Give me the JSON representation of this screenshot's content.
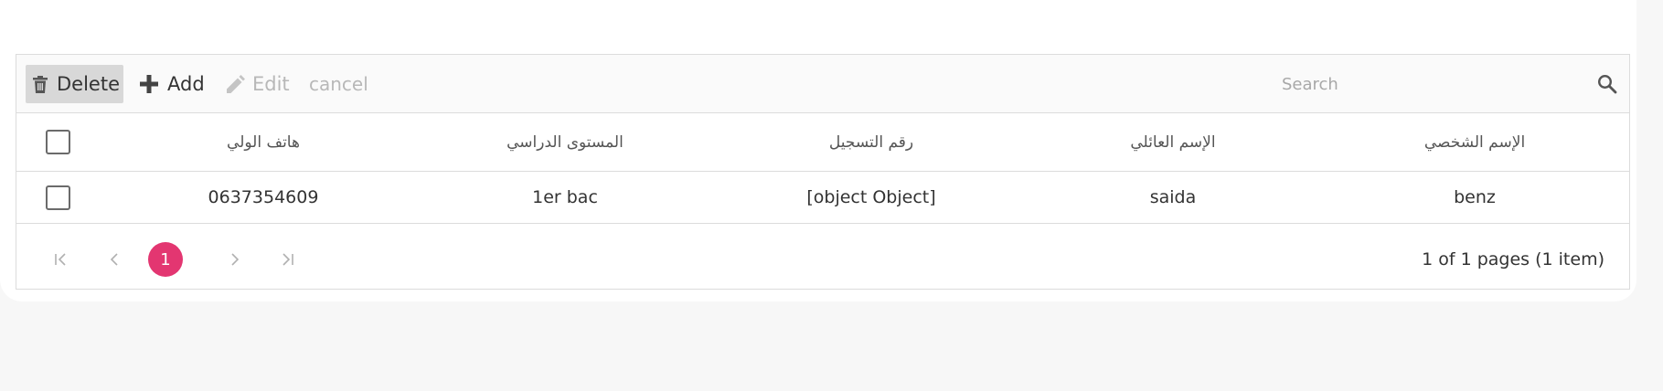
{
  "toolbar": {
    "delete_label": "Delete",
    "add_label": "Add",
    "edit_label": "Edit",
    "cancel_label": "cancel",
    "search_placeholder": "Search",
    "search_value": ""
  },
  "icons": {
    "delete": "trash-icon",
    "add": "plus-icon",
    "edit": "pencil-icon",
    "search": "search-icon",
    "first": "page-first-icon",
    "prev": "chevron-left-icon",
    "next": "chevron-right-icon",
    "last": "page-last-icon"
  },
  "table": {
    "columns": [
      "هاتف الولي",
      "المستوى الدراسي",
      "رقم التسجيل",
      "الإسم العائلي",
      "الإسم الشخصي"
    ],
    "rows": [
      {
        "cells": [
          "0637354609",
          "1er bac",
          "[object Object]",
          "saida",
          "benz"
        ]
      }
    ]
  },
  "pager": {
    "current_page": "1",
    "info": "1 of 1 pages (1 item)"
  },
  "colors": {
    "accent": "#e33671",
    "toolbar_bg": "#fafafa",
    "border": "#dcdcdc",
    "page_bg": "#f7f7f7"
  }
}
